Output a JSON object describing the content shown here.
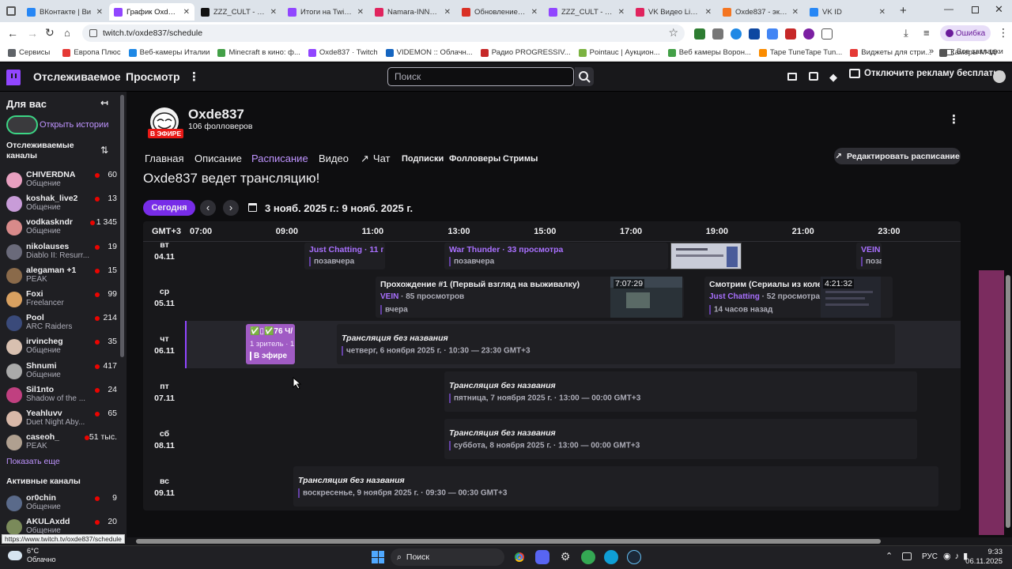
{
  "browser": {
    "tabs": [
      {
        "title": "ВКонтакте | Ви",
        "color": "#2787f5"
      },
      {
        "title": "График Oxde837",
        "color": "#9146ff"
      },
      {
        "title": "ZZZ_CULT - Смот",
        "color": "#111111"
      },
      {
        "title": "Итоги на Twitch",
        "color": "#9146ff"
      },
      {
        "title": "Namara-INNER-",
        "color": "#e0245e"
      },
      {
        "title": "Обновление по",
        "color": "#d93025"
      },
      {
        "title": "ZZZ_CULT - Twitc",
        "color": "#9146ff"
      },
      {
        "title": "VK Видео Live —",
        "color": "#e0245e"
      },
      {
        "title": "Oxde837 - экскл",
        "color": "#f47521"
      },
      {
        "title": "VK ID",
        "color": "#2787f5"
      }
    ],
    "url": "twitch.tv/oxde837/schedule",
    "error_label": "Ошибка",
    "bookmarks": [
      "Сервисы",
      "Европа Плюс",
      "Веб-камеры Италии",
      "Minecraft в кино: ф...",
      "Oxde837 · Twitch",
      "VIDEMON :: Облачн...",
      "Радио PROGRESSIV...",
      "Pointauc | Аукцион...",
      "Веб камеры Ворон...",
      "Tape TuneTape Tun...",
      "Виджеты для стри...",
      "Камеры М-16"
    ],
    "all_bookmarks": "Все закладки",
    "status_url": "https://www.twitch.tv/oxde837/schedule"
  },
  "topnav": {
    "following": "Отслеживаемое",
    "browse": "Просмотр",
    "search_placeholder": "Поиск",
    "turbo": "Отключите рекламу бесплатно"
  },
  "sidebar": {
    "for_you": "Для вас",
    "stories": "Открыть истории",
    "followed_title": "Отслеживаемые каналы",
    "channels": [
      {
        "name": "CHIVERDNA",
        "game": "Общение",
        "viewers": "60",
        "color": "#e8a0c0"
      },
      {
        "name": "koshak_live2",
        "game": "Общение",
        "viewers": "13",
        "color": "#c89cd8"
      },
      {
        "name": "vodkaskndr",
        "game": "Общение",
        "viewers": "1 345",
        "color": "#d88a8a"
      },
      {
        "name": "nikolauses",
        "game": "Diablo II: Resurr...",
        "viewers": "19",
        "color": "#6a6a7a"
      },
      {
        "name": "alegaman +1",
        "game": "PEAK",
        "viewers": "15",
        "color": "#8a6a4a"
      },
      {
        "name": "Foxi",
        "game": "Freelancer",
        "viewers": "99",
        "color": "#d8a060"
      },
      {
        "name": "Pool",
        "game": "ARC Raiders",
        "viewers": "214",
        "color": "#3a4a7a"
      },
      {
        "name": "irvincheg",
        "game": "Общение",
        "viewers": "35",
        "color": "#d8c0b0"
      },
      {
        "name": "Shnumi",
        "game": "Общение",
        "viewers": "417",
        "color": "#aaaaaa"
      },
      {
        "name": "Sil1nto",
        "game": "Shadow of the ...",
        "viewers": "24",
        "color": "#c04080"
      },
      {
        "name": "Yeahluvv",
        "game": "Duet Night Aby...",
        "viewers": "65",
        "color": "#d8b8a8"
      },
      {
        "name": "caseoh_",
        "game": "PEAK",
        "viewers": "51 тыс.",
        "color": "#b0a090"
      }
    ],
    "show_more": "Показать еще",
    "active_title": "Активные каналы",
    "active": [
      {
        "name": "or0chin",
        "game": "Общение",
        "viewers": "9",
        "color": "#5a6a8a"
      },
      {
        "name": "AKULAxdd",
        "game": "Общение",
        "viewers": "20",
        "color": "#7a8a5a"
      }
    ]
  },
  "channel": {
    "name": "Oxde837",
    "followers": "106 фолловеров",
    "live_badge": "В ЭФИРЕ",
    "tabs": {
      "home": "Главная",
      "about": "Описание",
      "schedule": "Расписание",
      "videos": "Видео",
      "chat": "Чат",
      "subs": "Подписки",
      "followers": "Фолловеры",
      "streams": "Стримы"
    },
    "edit_schedule": "Редактировать расписание",
    "live_heading": "Oxde837 ведет трансляцию!"
  },
  "schedule": {
    "today": "Сегодня",
    "date_range": "3 нояб. 2025 г.: 9 нояб. 2025 г.",
    "timezone": "GMT+3",
    "hours": [
      "07:00",
      "09:00",
      "11:00",
      "13:00",
      "15:00",
      "17:00",
      "19:00",
      "21:00",
      "23:00"
    ],
    "days": [
      {
        "dow": "вт",
        "date": "04.11"
      },
      {
        "dow": "ср",
        "date": "05.11"
      },
      {
        "dow": "чт",
        "date": "06.11"
      },
      {
        "dow": "пт",
        "date": "07.11"
      },
      {
        "dow": "сб",
        "date": "08.11"
      },
      {
        "dow": "вс",
        "date": "09.11"
      }
    ],
    "tue": [
      {
        "title": "Just Chatting · 11 прс",
        "sub": "позавчера"
      },
      {
        "title": "War Thunder · 33 просмотра",
        "sub": "позавчера"
      },
      {
        "title": "VEIN",
        "sub": "поза"
      }
    ],
    "wed": [
      {
        "title": "Прохождение #1 (Первый взгляд на выживалку)",
        "game": "VEIN",
        "meta": " · 85 просмотров",
        "sub": "вчера",
        "duration": "7:07:29"
      },
      {
        "title": "Смотрим (Сериалы из колеса",
        "game": "Just Chatting",
        "meta": " · 52 просмотра",
        "sub": "14 часов назад",
        "duration": "4:21:32"
      }
    ],
    "live": {
      "title": "✅▯✅76 Ч/",
      "viewers": "1 зритель · 1",
      "badge": "В эфире"
    },
    "thu": {
      "title": "Трансляция без названия",
      "sub": "четверг, 6 ноября 2025 г. · 10:30 — 23:30 GMT+3"
    },
    "fri": {
      "title": "Трансляция без названия",
      "sub": "пятница, 7 ноября 2025 г. · 13:00 — 00:00 GMT+3"
    },
    "sat": {
      "title": "Трансляция без названия",
      "sub": "суббота, 8 ноября 2025 г. · 13:00 — 00:00 GMT+3"
    },
    "sun": {
      "title": "Трансляция без названия",
      "sub": "воскресенье, 9 ноября 2025 г. · 09:30 — 00:30 GMT+3"
    }
  },
  "taskbar": {
    "temp": "6°C",
    "weather": "Облачно",
    "search": "Поиск",
    "lang": "РУС",
    "time": "9:33",
    "date": "06.11.2025"
  }
}
